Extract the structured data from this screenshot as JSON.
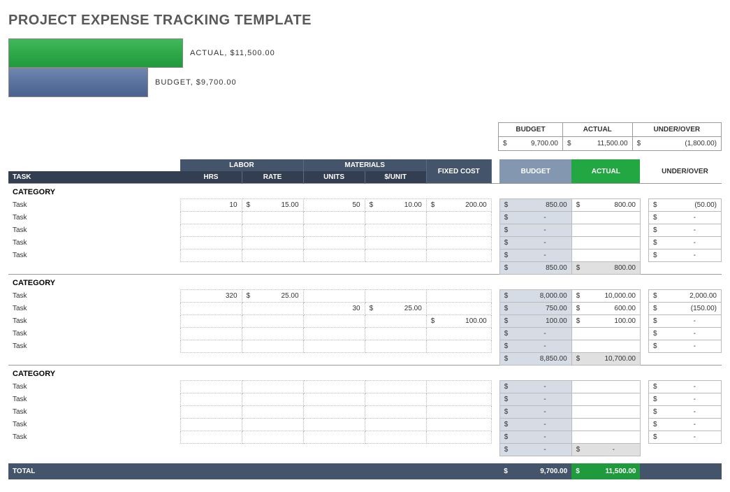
{
  "title": "PROJECT EXPENSE TRACKING TEMPLATE",
  "chart": {
    "actual_label": "ACTUAL,  $11,500.00",
    "budget_label": "BUDGET,  $9,700.00"
  },
  "chart_data": {
    "type": "bar",
    "categories": [
      "ACTUAL",
      "BUDGET"
    ],
    "values": [
      11500.0,
      9700.0
    ],
    "orientation": "horizontal",
    "title": "",
    "xlabel": "",
    "ylabel": ""
  },
  "summary": {
    "headers": {
      "budget": "BUDGET",
      "actual": "ACTUAL",
      "over": "UNDER/OVER"
    },
    "budget": "9,700.00",
    "actual": "11,500.00",
    "over": "(1,800.00)"
  },
  "columns": {
    "task": "TASK",
    "labor": "LABOR",
    "materials": "MATERIALS",
    "fixed": "FIXED COST",
    "budget": "BUDGET",
    "actual": "ACTUAL",
    "over": "UNDER/OVER",
    "hrs": "HRS",
    "rate": "RATE",
    "units": "UNITS",
    "punit": "$/UNIT"
  },
  "categories": [
    {
      "name": "CATEGORY",
      "rows": [
        {
          "task": "Task",
          "hrs": "10",
          "rate": "15.00",
          "units": "50",
          "punit": "10.00",
          "fixed": "200.00",
          "budget": "850.00",
          "actual": "800.00",
          "over": "(50.00)"
        },
        {
          "task": "Task",
          "hrs": "",
          "rate": "",
          "units": "",
          "punit": "",
          "fixed": "",
          "budget": "-",
          "actual": "",
          "over": "-"
        },
        {
          "task": "Task",
          "hrs": "",
          "rate": "",
          "units": "",
          "punit": "",
          "fixed": "",
          "budget": "-",
          "actual": "",
          "over": "-"
        },
        {
          "task": "Task",
          "hrs": "",
          "rate": "",
          "units": "",
          "punit": "",
          "fixed": "",
          "budget": "-",
          "actual": "",
          "over": "-"
        },
        {
          "task": "Task",
          "hrs": "",
          "rate": "",
          "units": "",
          "punit": "",
          "fixed": "",
          "budget": "-",
          "actual": "",
          "over": "-"
        }
      ],
      "subtotal": {
        "budget": "850.00",
        "actual": "800.00"
      }
    },
    {
      "name": "CATEGORY",
      "rows": [
        {
          "task": "Task",
          "hrs": "320",
          "rate": "25.00",
          "units": "",
          "punit": "",
          "fixed": "",
          "budget": "8,000.00",
          "actual": "10,000.00",
          "over": "2,000.00"
        },
        {
          "task": "Task",
          "hrs": "",
          "rate": "",
          "units": "30",
          "punit": "25.00",
          "fixed": "",
          "budget": "750.00",
          "actual": "600.00",
          "over": "(150.00)"
        },
        {
          "task": "Task",
          "hrs": "",
          "rate": "",
          "units": "",
          "punit": "",
          "fixed": "100.00",
          "budget": "100.00",
          "actual": "100.00",
          "over": "-"
        },
        {
          "task": "Task",
          "hrs": "",
          "rate": "",
          "units": "",
          "punit": "",
          "fixed": "",
          "budget": "-",
          "actual": "",
          "over": "-"
        },
        {
          "task": "Task",
          "hrs": "",
          "rate": "",
          "units": "",
          "punit": "",
          "fixed": "",
          "budget": "-",
          "actual": "",
          "over": "-"
        }
      ],
      "subtotal": {
        "budget": "8,850.00",
        "actual": "10,700.00"
      }
    },
    {
      "name": "CATEGORY",
      "rows": [
        {
          "task": "Task",
          "hrs": "",
          "rate": "",
          "units": "",
          "punit": "",
          "fixed": "",
          "budget": "-",
          "actual": "",
          "over": "-"
        },
        {
          "task": "Task",
          "hrs": "",
          "rate": "",
          "units": "",
          "punit": "",
          "fixed": "",
          "budget": "-",
          "actual": "",
          "over": "-"
        },
        {
          "task": "Task",
          "hrs": "",
          "rate": "",
          "units": "",
          "punit": "",
          "fixed": "",
          "budget": "-",
          "actual": "",
          "over": "-"
        },
        {
          "task": "Task",
          "hrs": "",
          "rate": "",
          "units": "",
          "punit": "",
          "fixed": "",
          "budget": "-",
          "actual": "",
          "over": "-"
        },
        {
          "task": "Task",
          "hrs": "",
          "rate": "",
          "units": "",
          "punit": "",
          "fixed": "",
          "budget": "-",
          "actual": "",
          "over": "-"
        }
      ],
      "subtotal": {
        "budget": "-",
        "actual": "-"
      }
    }
  ],
  "total": {
    "label": "TOTAL",
    "budget": "9,700.00",
    "actual": "11,500.00"
  }
}
